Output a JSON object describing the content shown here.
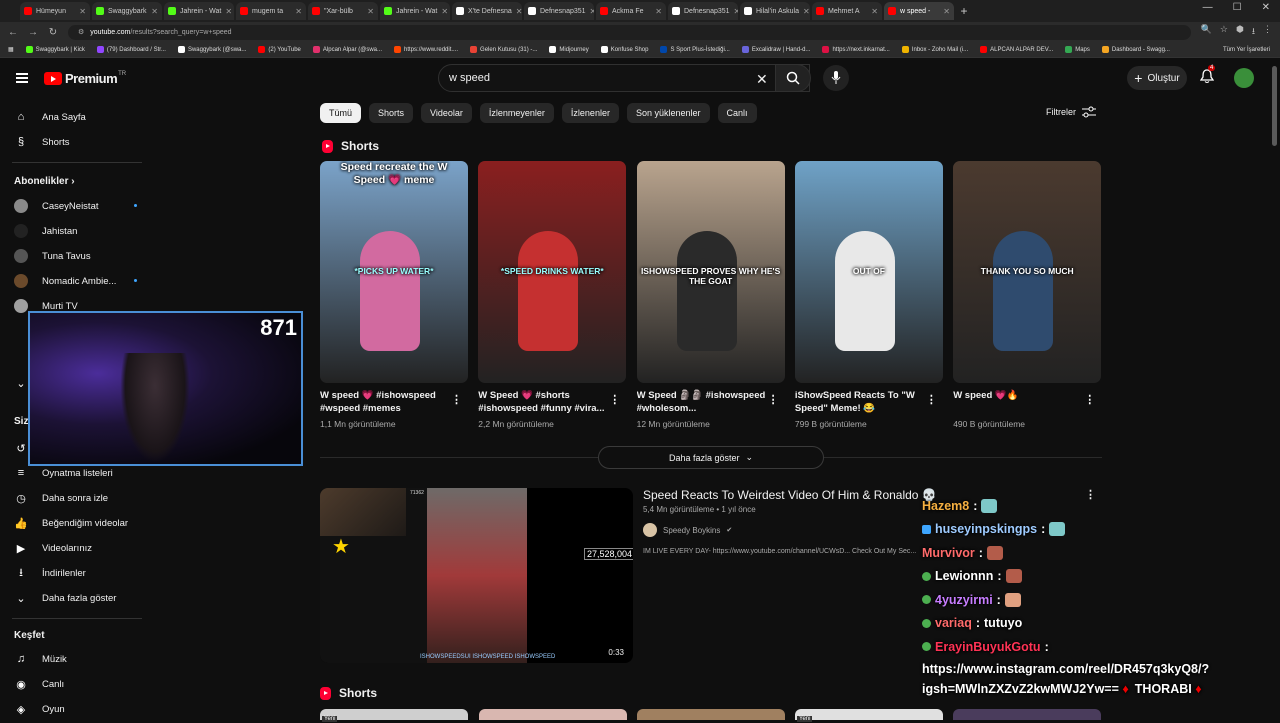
{
  "browser": {
    "tabs": [
      {
        "label": "Hümeyun",
        "color": "#ff0000"
      },
      {
        "label": "Swaggybark",
        "color": "#53fc18"
      },
      {
        "label": "Jahrein - Wat",
        "color": "#53fc18"
      },
      {
        "label": "mugem ta",
        "color": "#ff0000"
      },
      {
        "label": "\"Xar-bülb",
        "color": "#ff0000"
      },
      {
        "label": "Jahrein - Wat",
        "color": "#53fc18"
      },
      {
        "label": "X'te Defnesna",
        "color": "#ffffff"
      },
      {
        "label": "Defnesnap351",
        "color": "#ffffff"
      },
      {
        "label": "Ackma Fe",
        "color": "#ff0000"
      },
      {
        "label": "Defnesnap351",
        "color": "#ffffff"
      },
      {
        "label": "Hilal'in Askula",
        "color": "#ffffff"
      },
      {
        "label": "Mehmet A",
        "color": "#ff0000"
      },
      {
        "label": "w speed -",
        "color": "#ff0000"
      }
    ],
    "url_host": "youtube.com",
    "url_path": "/results?search_query=w+speed",
    "bookmarks": [
      {
        "label": "Swaggybark | Kick",
        "color": "#53fc18"
      },
      {
        "label": "(79) Dashboard / Str...",
        "color": "#9146ff"
      },
      {
        "label": "Swaggybark (@swa...",
        "color": "#ffffff"
      },
      {
        "label": "(2) YouTube",
        "color": "#ff0000"
      },
      {
        "label": "Alpcan Alpar (@swa...",
        "color": "#e1306c"
      },
      {
        "label": "https://www.reddit....",
        "color": "#ff4500"
      },
      {
        "label": "Gelen Kutusu (31) -...",
        "color": "#ea4335"
      },
      {
        "label": "Midjourney",
        "color": "#ffffff"
      },
      {
        "label": "Konfuse Shop",
        "color": "#ffffff"
      },
      {
        "label": "S Sport Plus-İstediği...",
        "color": "#0047ab"
      },
      {
        "label": "Excalidraw | Hand-d...",
        "color": "#6965db"
      },
      {
        "label": "https://next.inkarnat...",
        "color": "#d14"
      },
      {
        "label": "Inbox - Zoho Mail (i...",
        "color": "#f0b400"
      },
      {
        "label": "ALPCAN ALPAR DEV...",
        "color": "#ff0000"
      },
      {
        "label": "Maps",
        "color": "#34a853"
      },
      {
        "label": "Dashboard - Swagg...",
        "color": "#f5a623"
      }
    ],
    "all_bookmarks": "Tüm Yer İşaretleri"
  },
  "header": {
    "logo_text": "Premium",
    "logo_country": "TR",
    "search_value": "w speed",
    "create_label": "Oluştur",
    "notifications": "4"
  },
  "sidebar": {
    "items": [
      {
        "label": "Ana Sayfa",
        "icon": "home-icon"
      },
      {
        "label": "Shorts",
        "icon": "shorts-icon"
      }
    ],
    "subscriptions_title": "Abonelikler",
    "subscriptions": [
      {
        "label": "CaseyNeistat",
        "color": "#8a8a8a",
        "live": true
      },
      {
        "label": "Jahistan",
        "color": "#222222",
        "live": false
      },
      {
        "label": "Tuna Tavus",
        "color": "#555555",
        "live": false
      },
      {
        "label": "Nomadic Ambie...",
        "color": "#6b4a2b",
        "live": true
      },
      {
        "label": "Murti TV",
        "color": "#a0a0a0",
        "live": false
      }
    ],
    "you_title": "Siz",
    "you_items": [
      {
        "label": "Oynatma listeleri",
        "icon": "playlist-icon"
      },
      {
        "label": "Daha sonra izle",
        "icon": "clock-icon"
      },
      {
        "label": "Beğendiğim videolar",
        "icon": "thumbs-up-icon"
      },
      {
        "label": "Videolarınız",
        "icon": "video-icon"
      },
      {
        "label": "İndirilenler",
        "icon": "download-icon"
      },
      {
        "label": "Daha fazla göster",
        "icon": "chevron-down-icon"
      }
    ],
    "explore_title": "Keşfet",
    "explore_items": [
      {
        "label": "Müzik",
        "icon": "music-icon"
      },
      {
        "label": "Canlı",
        "icon": "live-icon"
      },
      {
        "label": "Oyun",
        "icon": "gaming-icon"
      }
    ]
  },
  "webcam": {
    "counter": "871"
  },
  "filters": {
    "chips": [
      "Tümü",
      "Shorts",
      "Videolar",
      "İzlenmeyenler",
      "İzlenenler",
      "Son yüklenenler",
      "Canlı"
    ],
    "filters_label": "Filtreler"
  },
  "shorts_section": {
    "title": "Shorts",
    "items": [
      {
        "title": "W speed 💗 #ishowspeed #wspeed #memes",
        "views": "1,1 Mn görüntüleme",
        "caption_top": "Speed recreate the W Speed 💗 meme",
        "caption_mid": "*PICKS UP WATER*",
        "bg": "#7ba3c9",
        "fig": "#d26aa0"
      },
      {
        "title": "W Speed 💗 #shorts #ishowspeed #funny #vira...",
        "views": "2,2 Mn görüntüleme",
        "caption_top": "",
        "caption_mid": "*SPEED DRINKS WATER*",
        "bg": "#8a1f1f",
        "fig": "#c53030"
      },
      {
        "title": "W Speed 🗿🗿 #ishowspeed #wholesom...",
        "views": "12 Mn görüntüleme",
        "caption_top": "",
        "caption_mid": "ISHOWSPEED PROVES WHY HE'S THE GOAT",
        "bg": "#b9a48e",
        "fig": "#2a2a2a"
      },
      {
        "title": "iShowSpeed Reacts To \"W Speed\" Meme! 😂",
        "views": "799 B görüntüleme",
        "caption_top": "",
        "caption_mid": "OUT OF",
        "bg": "#6fa2c7",
        "fig": "#e8e8e8"
      },
      {
        "title": "W speed 💗🔥",
        "views": "490 B görüntüleme",
        "caption_top": "",
        "caption_mid": "THANK YOU SO MUCH",
        "bg": "#4b3a2f",
        "fig": "#2f4b6e"
      }
    ],
    "show_more": "Daha fazla göster"
  },
  "video_result": {
    "title": "Speed Reacts To Weirdest Video Of Him & Ronaldo 💀",
    "views": "5,4 Mn görüntüleme",
    "age": "1 yıl önce",
    "channel": "Speedy Boykins",
    "description": "IM LIVE EVERY DAY- https://www.youtube.com/channel/UCWsD... Check Out My Sec...",
    "overlay_views": "27,528,004",
    "duration": "0:33",
    "overlay_counter": "71362",
    "handles": "ISHOWSPEEDSUI ISHOWSPEED ISHOWSPEED"
  },
  "chat": [
    {
      "user": "Hazem8",
      "color": "#f5b041",
      "msg": "",
      "emote": "#7ec8c8"
    },
    {
      "user": "huseyinpskingps",
      "color": "#9ecbff",
      "msg": "",
      "emote": "#7ec8c8"
    },
    {
      "user": "Murvivor",
      "color": "#ff6b6b",
      "msg": "",
      "emote": "#b35c4a"
    },
    {
      "user": "Lewionnn",
      "color": "#ffffff",
      "msg": "",
      "emote": "#b35c4a"
    },
    {
      "user": "4yuzyirmi",
      "color": "#c77dff",
      "msg": "",
      "emote": "#e0a080"
    },
    {
      "user": "variaq",
      "color": "#ff6b6b",
      "msg": "tutuyo",
      "emote": ""
    },
    {
      "user": "ErayinBuyukGotu",
      "color": "#ff3355",
      "msg": "",
      "emote": ""
    }
  ],
  "chat_link": "https://www.instagram.com/reel/DR457q3kyQ8/?igsh=MWlnZXZvZ2kwMWJ2Yw==",
  "chat_link_tail": "THORABI",
  "shorts_section2": {
    "title": "Shorts",
    "badge": "Yeni"
  }
}
